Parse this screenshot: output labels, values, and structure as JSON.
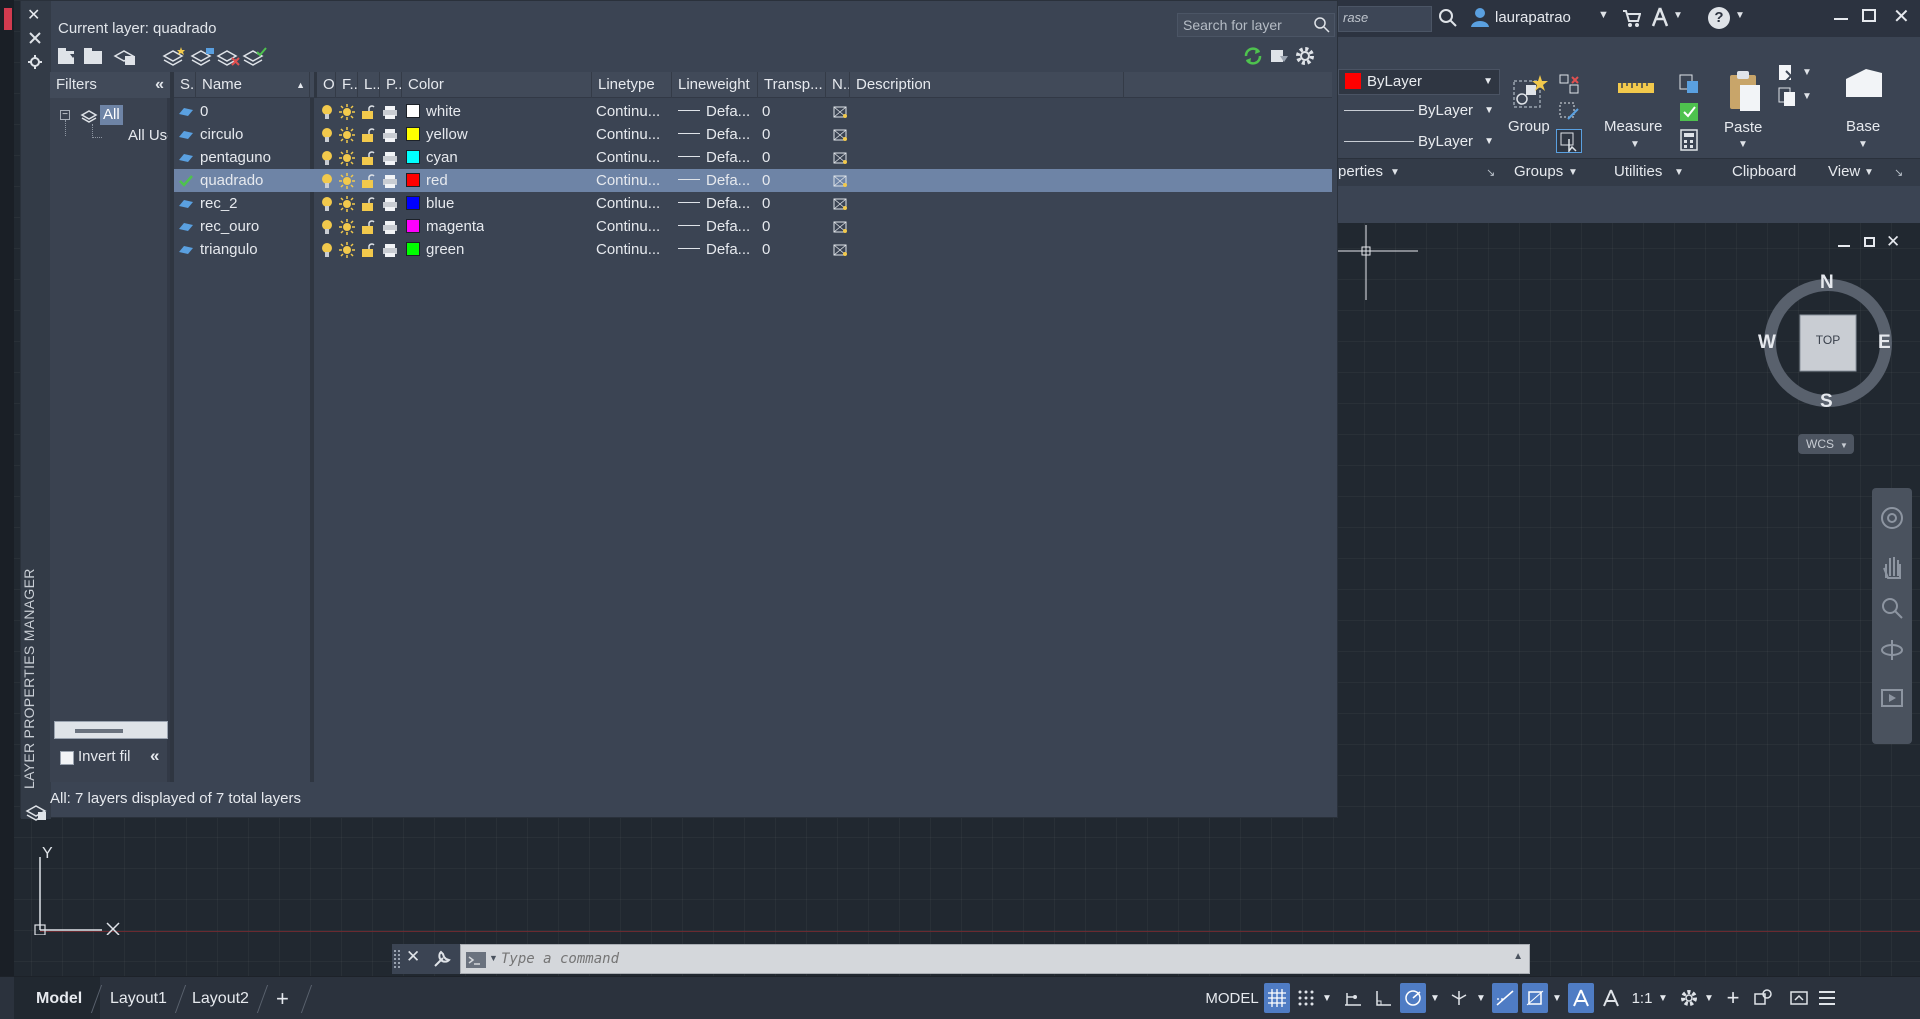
{
  "palette": {
    "vertical_title": "LAYER PROPERTIES MANAGER",
    "current_layer_label": "Current layer: quadrado",
    "search_placeholder": "Search for layer",
    "footer_status": "All: 7 layers displayed of 7 total layers",
    "filters_header": "Filters",
    "filter_tree": {
      "all": "All",
      "all_used": "All Use"
    },
    "invert_filter_label": "Invert fil"
  },
  "table": {
    "headers": [
      "S...",
      "Name",
      "O...",
      "F...",
      "L...",
      "P...",
      "Color",
      "Linetype",
      "Lineweight",
      "Transp...",
      "N...",
      "Description"
    ],
    "rows": [
      {
        "name": "0",
        "color_name": "white",
        "color_hex": "#ffffff",
        "linetype": "Continu...",
        "lineweight": "Defa...",
        "transparency": "0",
        "current": false,
        "selected": false
      },
      {
        "name": "circulo",
        "color_name": "yellow",
        "color_hex": "#ffff00",
        "linetype": "Continu...",
        "lineweight": "Defa...",
        "transparency": "0",
        "current": false,
        "selected": false
      },
      {
        "name": "pentaguno",
        "color_name": "cyan",
        "color_hex": "#00ffff",
        "linetype": "Continu...",
        "lineweight": "Defa...",
        "transparency": "0",
        "current": false,
        "selected": false
      },
      {
        "name": "quadrado",
        "color_name": "red",
        "color_hex": "#ff0000",
        "linetype": "Continu...",
        "lineweight": "Defa...",
        "transparency": "0",
        "current": true,
        "selected": true
      },
      {
        "name": "rec_2",
        "color_name": "blue",
        "color_hex": "#0000ff",
        "linetype": "Continu...",
        "lineweight": "Defa...",
        "transparency": "0",
        "current": false,
        "selected": false
      },
      {
        "name": "rec_ouro",
        "color_name": "magenta",
        "color_hex": "#ff00ff",
        "linetype": "Continu...",
        "lineweight": "Defa...",
        "transparency": "0",
        "current": false,
        "selected": false
      },
      {
        "name": "triangulo",
        "color_name": "green",
        "color_hex": "#00ff00",
        "linetype": "Continu...",
        "lineweight": "Defa...",
        "transparency": "0",
        "current": false,
        "selected": false
      }
    ]
  },
  "ribbon": {
    "search_text": "rase",
    "username": "laurapatrao",
    "layer_combo": "ByLayer",
    "linetype_combo": "ByLayer",
    "lineweight_combo": "ByLayer",
    "group_label": "Group",
    "measure_label": "Measure",
    "paste_label": "Paste",
    "base_label": "Base",
    "panel_properties": "perties",
    "panel_groups": "Groups",
    "panel_utilities": "Utilities",
    "panel_clipboard": "Clipboard",
    "panel_view": "View"
  },
  "viewcube": {
    "north": "N",
    "south": "S",
    "east": "E",
    "west": "W",
    "face": "TOP",
    "wcs": "WCS"
  },
  "ucs": {
    "y_label": "Y"
  },
  "command": {
    "placeholder": "Type a command"
  },
  "layout_tabs": {
    "model": "Model",
    "layout1": "Layout1",
    "layout2": "Layout2",
    "add": "+"
  },
  "status_bar": {
    "model_label": "MODEL",
    "scale_label": "1:1"
  },
  "colors": {
    "selected_row": "#6e84a6",
    "accent_active": "#4f7cc4",
    "check_green": "#4ec24e"
  }
}
